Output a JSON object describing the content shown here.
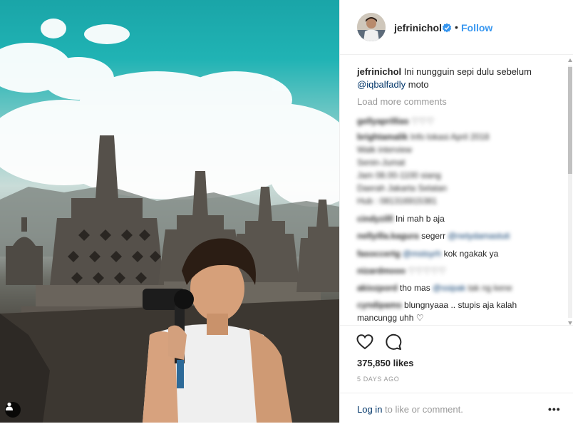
{
  "post": {
    "username": "jefrinichol",
    "follow_label": "Follow",
    "separator": "•"
  },
  "caption": {
    "username": "jefrinichol",
    "text": "Ini nungguin sepi dulu sebelum",
    "mention": "@iqbalfadly",
    "text_after": "moto"
  },
  "load_more": "Load more comments",
  "comments": [
    {
      "user": "gellyaprillias",
      "text": "♡♡♡"
    },
    {
      "user": "brightamalik",
      "text": "Info lokasi April 2018"
    },
    {
      "user": "",
      "text": "Walk interview"
    },
    {
      "user": "",
      "text": "Senin-Jumat"
    },
    {
      "user": "",
      "text": "Jam 08.00-1100 siang"
    },
    {
      "user": "",
      "text": "Daerah Jakarta Selatan"
    },
    {
      "user": "",
      "text": "Hub : 081316915381"
    },
    {
      "user": "cindyzilll",
      "text": "Ini mah b aja"
    },
    {
      "user": "nellyilla.kagura",
      "text": "segerr",
      "mention": "@netydamastuti"
    },
    {
      "user": "fasoccertg",
      "text": "kok ngakak ya",
      "mention": "@mstsyrh"
    },
    {
      "user": "nizardmooo",
      "text": "♡♡♡♡♡"
    },
    {
      "user": "akiozpord",
      "text": "tho mas",
      "mention": "@ssipak",
      "text_after": "tak ng kene"
    },
    {
      "user": "cyndipams",
      "text": "blungnyaaa .. stupis aja kalah"
    },
    {
      "user": "",
      "text": "mancungg uhh ♡"
    }
  ],
  "likes": "375,850 likes",
  "date": "5 DAYS AGO",
  "login": {
    "link": "Log in",
    "rest": "to like or comment."
  },
  "more_label": "•••",
  "colors": {
    "link": "#3897f0",
    "mention": "#003569",
    "muted": "#999999",
    "verified": "#3897f0"
  },
  "icons": {
    "like": "heart-icon",
    "comment": "comment-bubble-icon",
    "verified": "verified-badge-icon",
    "tag": "user-tag-icon"
  }
}
